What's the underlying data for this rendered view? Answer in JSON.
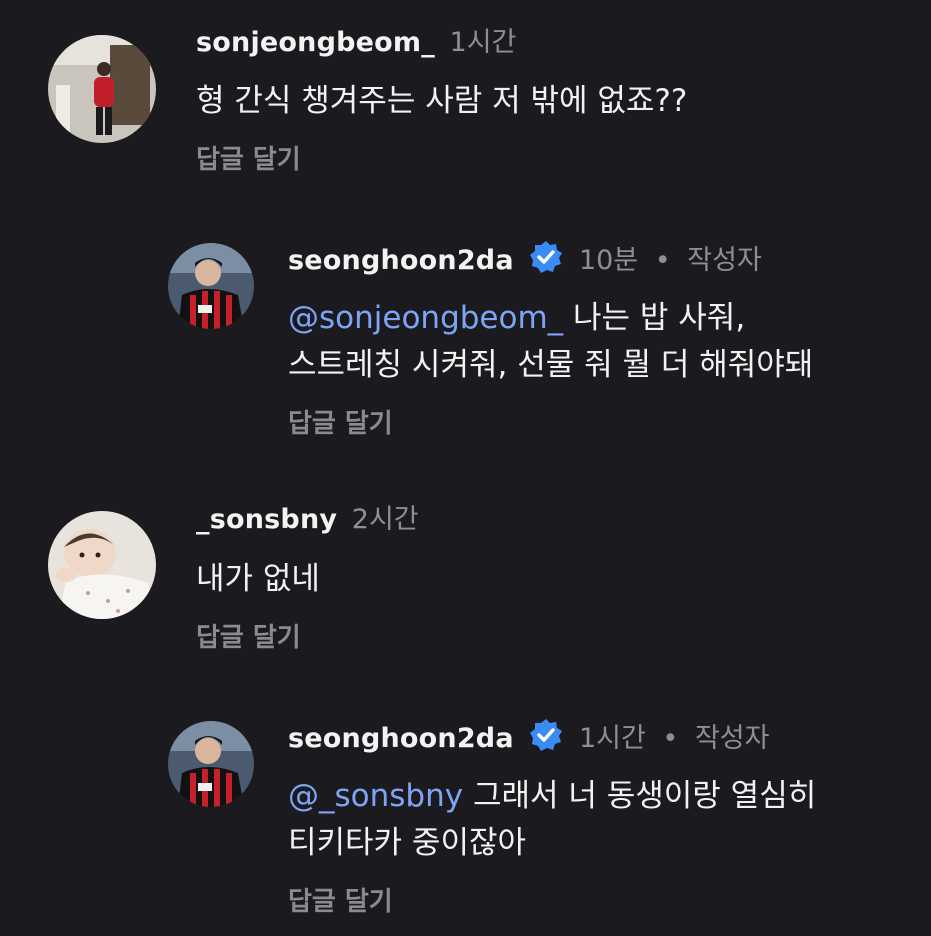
{
  "comments": [
    {
      "username": "sonjeongbeom_",
      "time": "1시간",
      "text": "형 간식 챙겨주는 사람 저 밖에 없죠??",
      "reply_label": "답글 달기",
      "avatar_icon": "profile-photo-person-red-sweater"
    },
    {
      "username": "seonghoon2da",
      "verified": true,
      "time": "10분",
      "separator": "•",
      "role": "작성자",
      "mention": "@sonjeongbeom_",
      "text_line1": "나는 밥 사줘,",
      "text_line2": "스트레칭 시켜줘, 선물 줘 뭘 더 해줘야돼",
      "reply_label": "답글 달기",
      "avatar_icon": "profile-photo-soccer-player"
    },
    {
      "username": "_sonsbny",
      "time": "2시간",
      "text": "내가 없네",
      "reply_label": "답글 달기",
      "avatar_icon": "profile-photo-baby"
    },
    {
      "username": "seonghoon2da",
      "verified": true,
      "time": "1시간",
      "separator": "•",
      "role": "작성자",
      "mention": "@_sonsbny",
      "text_line1": "그래서 너 동생이랑 열심히",
      "text_line2": "티키타카 중이잖아",
      "reply_label": "답글 달기",
      "avatar_icon": "profile-photo-soccer-player"
    }
  ],
  "colors": {
    "background": "#1b1b1f",
    "mention": "#7fa3f5",
    "verified_badge": "#3b8bf5",
    "muted": "#8e8e93"
  }
}
